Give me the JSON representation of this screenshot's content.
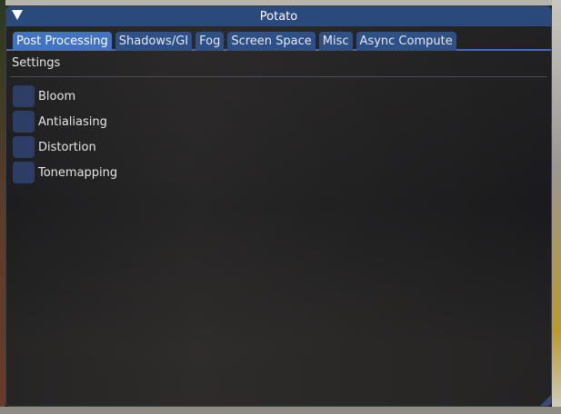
{
  "window": {
    "title": "Potato"
  },
  "tabs": [
    {
      "label": "Post Processing",
      "active": true
    },
    {
      "label": "Shadows/GI",
      "active": false
    },
    {
      "label": "Fog",
      "active": false
    },
    {
      "label": "Screen Space",
      "active": false
    },
    {
      "label": "Misc",
      "active": false
    },
    {
      "label": "Async Compute",
      "active": false
    }
  ],
  "section": {
    "label": "Settings"
  },
  "checkboxes": [
    {
      "label": "Bloom",
      "checked": false
    },
    {
      "label": "Antialiasing",
      "checked": false
    },
    {
      "label": "Distortion",
      "checked": false
    },
    {
      "label": "Tonemapping",
      "checked": false
    }
  ],
  "colors": {
    "titlebar": "#294a7a",
    "tab_active": "#4173c4",
    "tab_inactive": "#2e5088",
    "checkbox": "#2c3e66"
  }
}
